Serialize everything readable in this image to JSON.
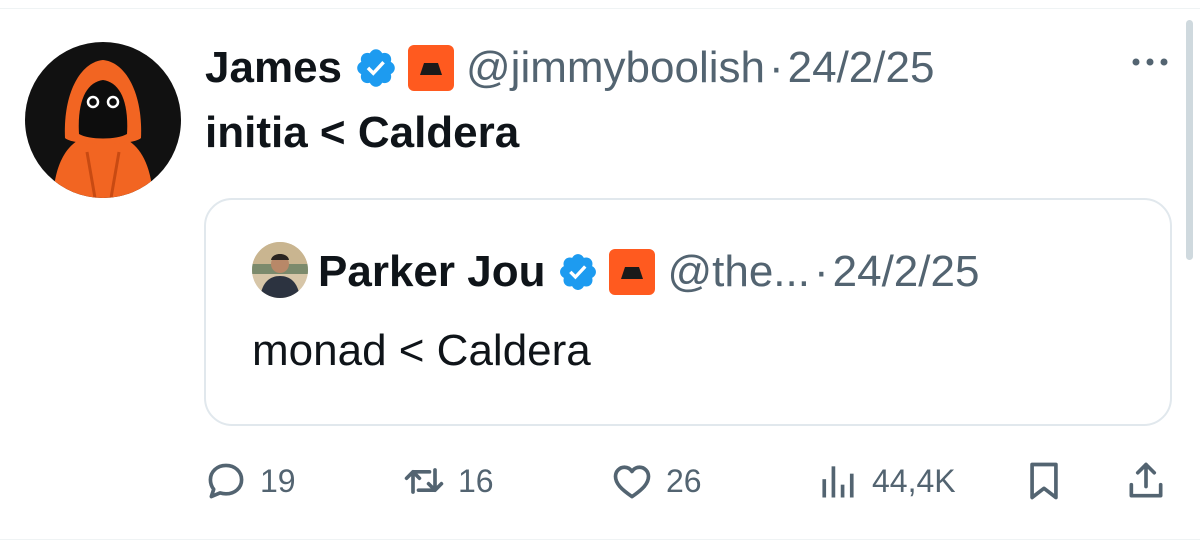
{
  "tweet": {
    "author_name": "James",
    "author_handle": "@jimmyboolish",
    "date_separator": "·",
    "date": "24/2/25",
    "text": "initia < Caldera",
    "more_icon": "ellipsis-icon"
  },
  "quote": {
    "author_name": "Parker Jou",
    "author_handle": "@the...",
    "date_separator": "·",
    "date": "24/2/25",
    "text": "monad < Caldera"
  },
  "actions": {
    "replies": "19",
    "retweets": "16",
    "likes": "26",
    "views": "44,4K"
  },
  "colors": {
    "verified": "#1d9bf0",
    "brand_badge": "#ff5a1f",
    "muted_text": "#536471",
    "primary_text": "#0f1419"
  }
}
